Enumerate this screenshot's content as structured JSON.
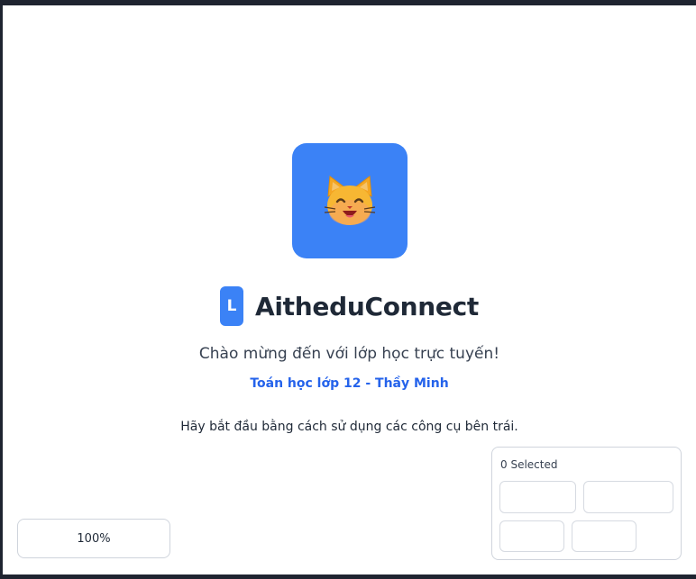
{
  "app": {
    "brand_initial": "L",
    "brand_name": "AitheduConnect",
    "logo_icon": "cat-face-emoji"
  },
  "welcome": {
    "message": "Chào mừng đến với lớp học trực tuyến!",
    "course": "Toán học lớp 12 - Thầy Minh",
    "hint": "Hãy bắt đầu bằng cách sử dụng các công cụ bên trái."
  },
  "zoom": {
    "level": "100%"
  },
  "selection": {
    "count_label": "0 Selected"
  },
  "colors": {
    "accent": "#3b82f6",
    "course_text": "#2563eb",
    "heading": "#1f2937"
  }
}
